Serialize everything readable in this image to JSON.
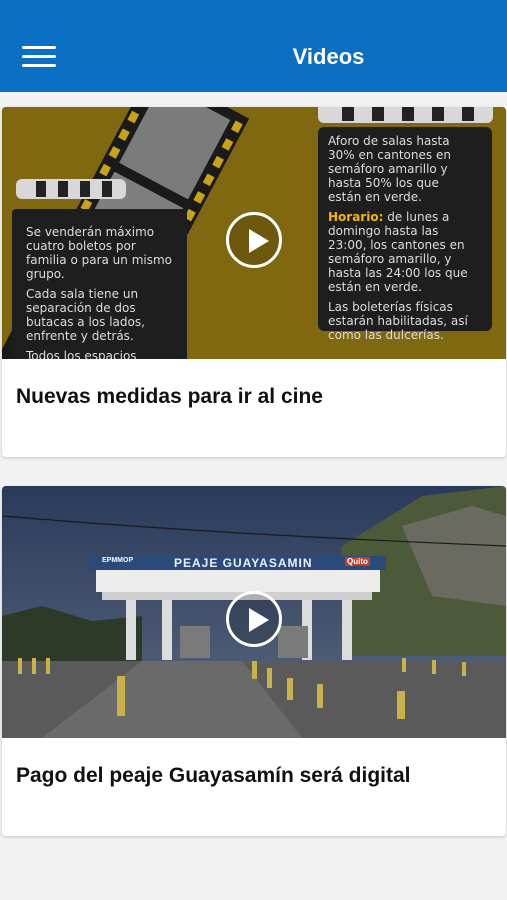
{
  "header": {
    "title": "Videos",
    "menu_icon": "hamburger-menu-icon",
    "background": "#0a6fc2"
  },
  "videos": [
    {
      "title": "Nuevas medidas para ir al cine",
      "thumbnail": {
        "left_text_1": "Se venderán máximo cuatro boletos por familia o para un mismo grupo.",
        "left_text_2": "Cada sala tiene un separación de dos butacas a los lados, enfrente y detrás.",
        "left_text_3": "Todos los espacios",
        "right_text_1": "Aforo de salas hasta 30% en cantones en semáforo amarillo y hasta 50% los que están en verde.",
        "right_label": "Horario:",
        "right_text_2": " de lunes a domingo hasta las 23:00, los cantones en semáforo amarillo, y hasta las 24:00 los que están en verde.",
        "right_text_3": "Las boleterías físicas estarán habilitadas, así como las dulcerías."
      }
    },
    {
      "title": "Pago del peaje Guayasamín será digital",
      "thumbnail": {
        "sign_text": "PEAJE GUAYASAMIN",
        "sign_left": "EPMMOP",
        "sign_right": "Quito"
      }
    }
  ],
  "icons": {
    "play": "play-icon"
  }
}
